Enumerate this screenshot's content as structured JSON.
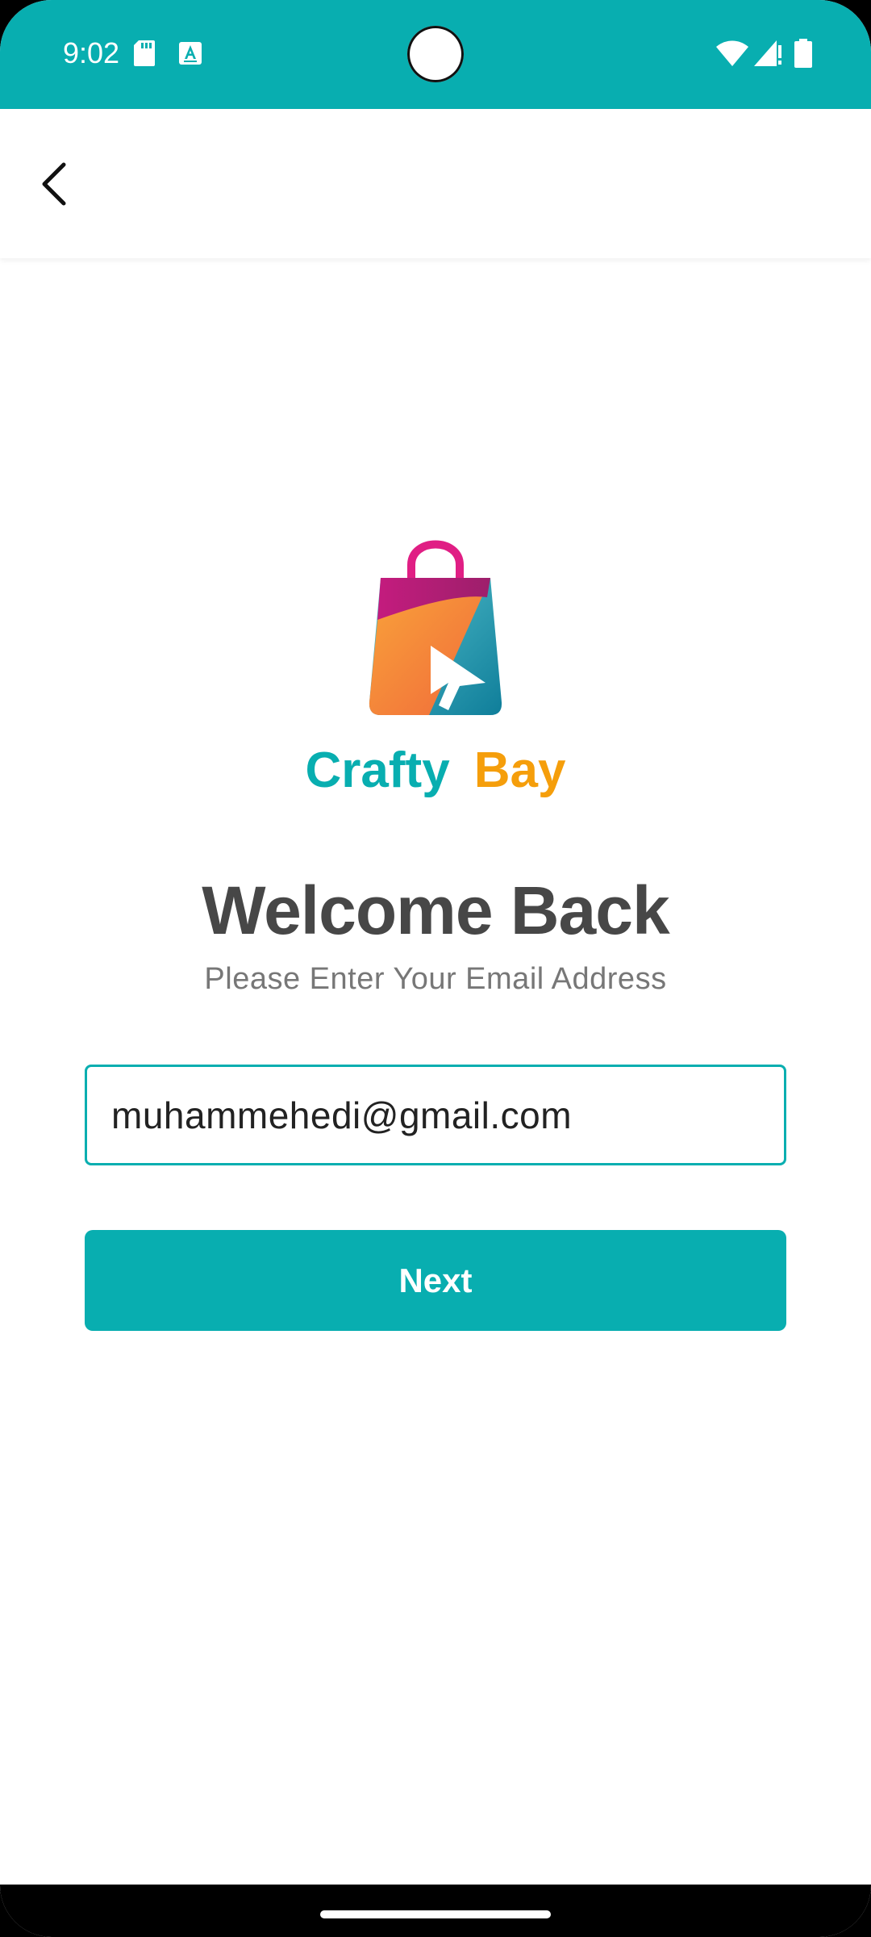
{
  "status_bar": {
    "time": "9:02",
    "icons": [
      "sd-card-icon",
      "accessibility-a-icon",
      "wifi-icon",
      "signal-icon",
      "battery-icon"
    ],
    "background": "#08AEB0"
  },
  "app_bar": {
    "back_icon": "chevron-left-icon"
  },
  "brand": {
    "part1": "Crafty",
    "part2": "Bay",
    "color1": "#08AEB0",
    "color2": "#F59E0B"
  },
  "welcome": {
    "title": "Welcome Back",
    "subtitle": "Please Enter Your Email Address"
  },
  "email": {
    "value": "muhammehedi@gmail.com"
  },
  "next_button": {
    "label": "Next"
  },
  "accent": "#08AEB0"
}
